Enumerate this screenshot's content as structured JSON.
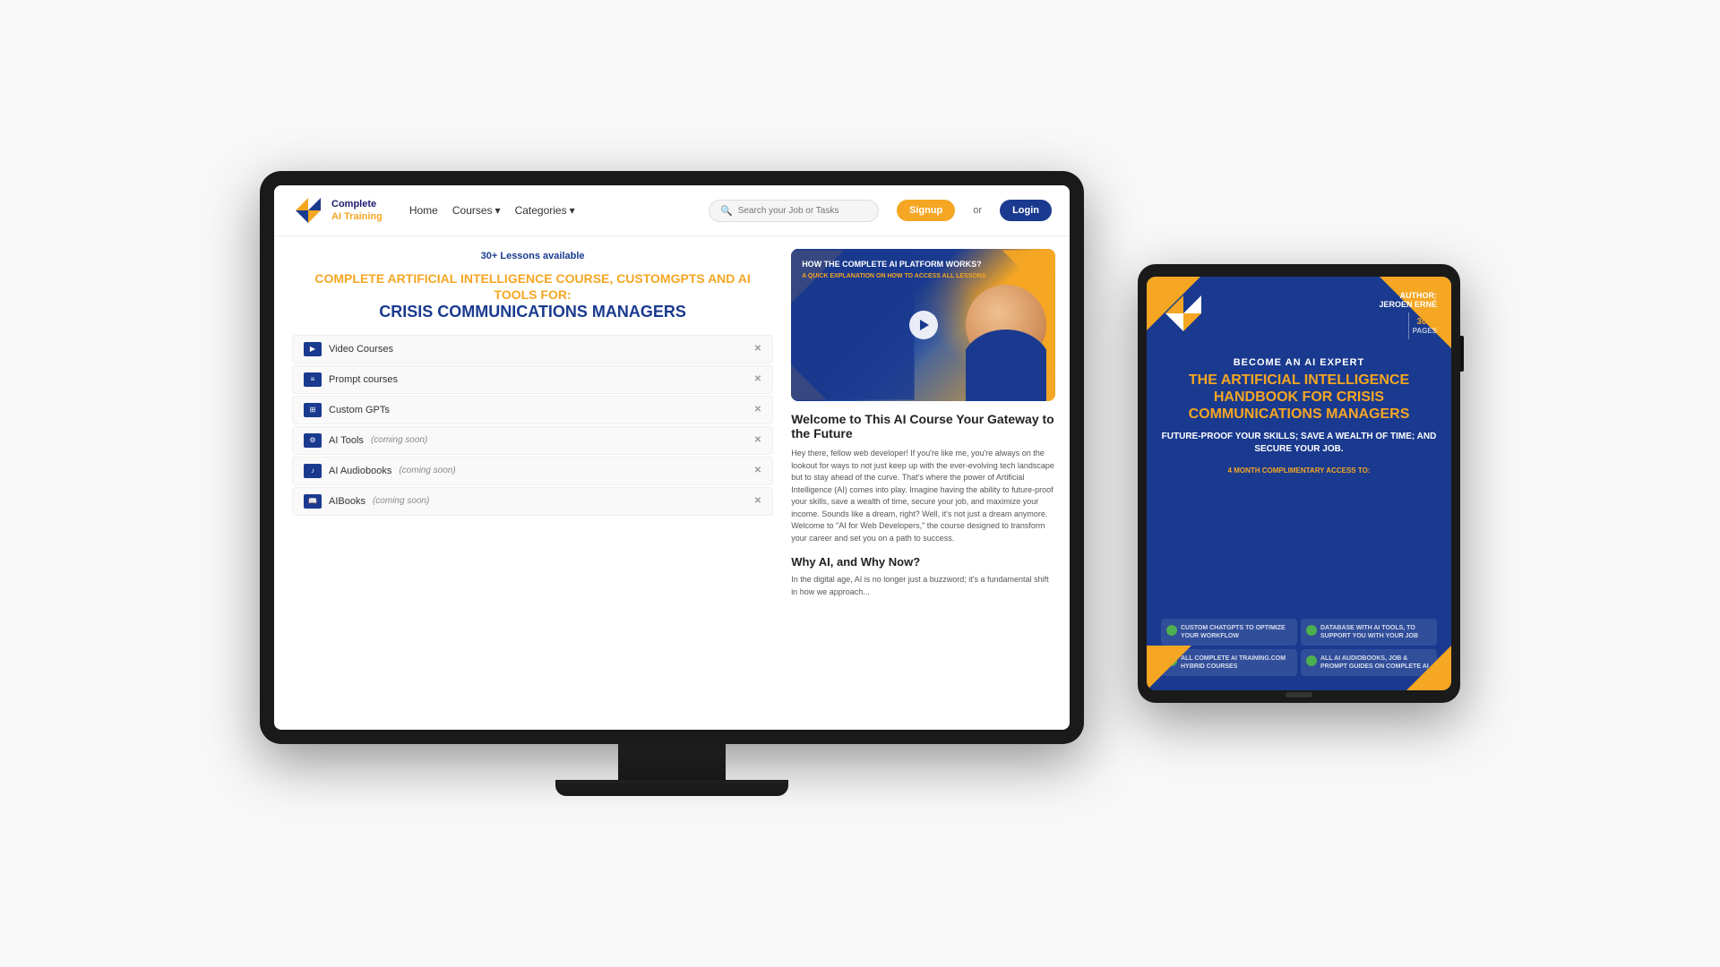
{
  "scene": {
    "bg_color": "#f0f0f0"
  },
  "monitor": {
    "nav": {
      "logo_line1": "Complete",
      "logo_line2": "AI",
      "logo_line3": "Training",
      "links": [
        {
          "label": "Home",
          "has_dropdown": false
        },
        {
          "label": "Courses",
          "has_dropdown": true
        },
        {
          "label": "Categories",
          "has_dropdown": true
        }
      ],
      "search_placeholder": "Search your Job or Tasks",
      "btn_signup": "Signup",
      "btn_or": "or",
      "btn_login": "Login"
    },
    "hero": {
      "badge": "30+ Lessons available",
      "title_line1": "COMPLETE ARTIFICIAL INTELLIGENCE COURSE, CUSTOMGPTS AND AI TOOLS FOR:",
      "title_line2": "CRISIS COMMUNICATIONS MANAGERS",
      "video_title": "HOW THE COMPLETE AI PLATFORM WORKS?",
      "video_subtitle": "A QUICK EXPLANATION ON HOW TO ACCESS ALL LESSONS"
    },
    "sidebar_items": [
      {
        "label": "Video Courses",
        "icon": "video"
      },
      {
        "label": "Prompt courses",
        "icon": "prompt"
      },
      {
        "label": "Custom GPTs",
        "icon": "gpt"
      },
      {
        "label": "AI Tools",
        "suffix": "(coming soon)",
        "icon": "tools"
      },
      {
        "label": "AI Audiobooks",
        "suffix": "(coming soon)",
        "icon": "audio"
      },
      {
        "label": "AIBooks",
        "suffix": "(coming soon)",
        "icon": "book"
      }
    ],
    "main_content": {
      "section_title": "Welcome to This AI Course Your Gateway to the Future",
      "section_body": "Hey there, fellow web developer! If you're like me, you're always on the lookout for ways to not just keep up with the ever-evolving tech landscape but to stay ahead of the curve. That's where the power of Artificial Intelligence (AI) comes into play. Imagine having the ability to future-proof your skills, save a wealth of time, secure your job, and maximize your income. Sounds like a dream, right? Well, it's not just a dream anymore. Welcome to \"AI for Web Developers,\" the course designed to transform your career and set you on a path to success.",
      "why_title": "Why AI, and Why Now?",
      "why_body": "In the digital age, AI is no longer just a buzzword; it's a fundamental shift in how we approach..."
    }
  },
  "tablet": {
    "author_label": "AUTHOR:",
    "author_name": "JEROEN ERNÉ",
    "pages_label": "300+",
    "pages_suffix": "PAGES",
    "become_label": "BECOME AN AI EXPERT",
    "main_title": "THE ARTIFICIAL INTELLIGENCE HANDBOOK FOR CRISIS COMMUNICATIONS MANAGERS",
    "subtitle": "FUTURE-PROOF YOUR SKILLS;\nSAVE A WEALTH OF TIME;\nAND SECURE YOUR JOB.",
    "complimentary": "4 MONTH COMPLIMENTARY ACCESS TO:",
    "footer_items": [
      {
        "text": "CUSTOM CHATGPTS TO OPTIMIZE YOUR WORKFLOW"
      },
      {
        "text": "DATABASE WITH AI TOOLS, TO SUPPORT YOU WITH YOUR JOB"
      },
      {
        "text": "ALL COMPLETE AI TRAINING.COM HYBRID COURSES"
      },
      {
        "text": "ALL AI AUDIOBOOKS, JOB & PROMPT GUIDES ON COMPLETE AI"
      }
    ]
  }
}
